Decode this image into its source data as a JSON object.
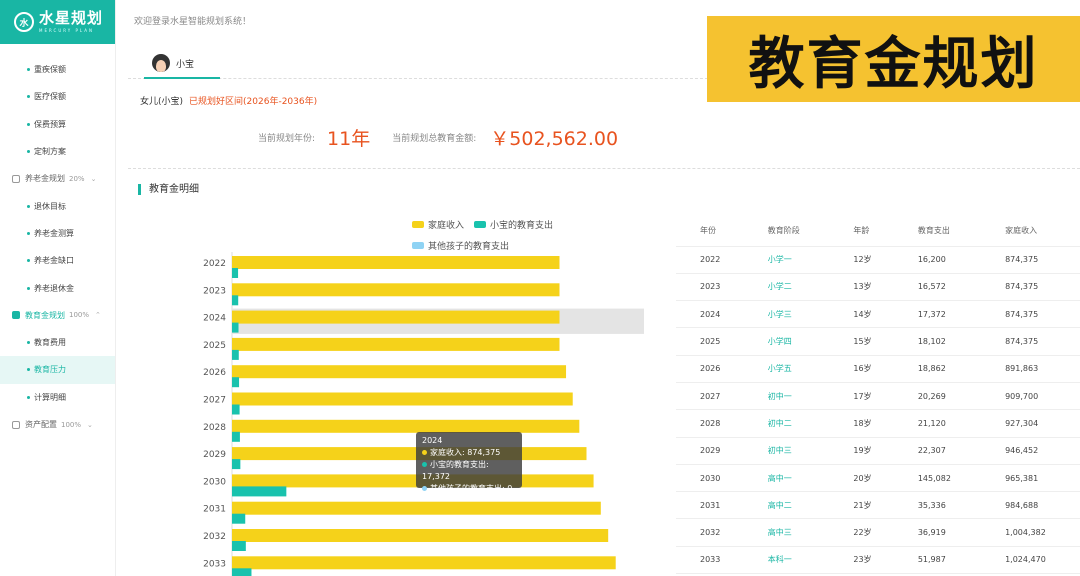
{
  "app": {
    "logo_name": "水星规划",
    "logo_sub": "MERCURY PLAN",
    "welcome": "欢迎登录水星智能规划系统！"
  },
  "sidebar": {
    "items": [
      {
        "label": "重疾保额",
        "type": "sub"
      },
      {
        "label": "医疗保额",
        "type": "sub"
      },
      {
        "label": "保费预算",
        "type": "sub"
      },
      {
        "label": "定制方案",
        "type": "sub"
      },
      {
        "label": "养老金规划",
        "type": "group",
        "pct": "20%"
      },
      {
        "label": "退休目标",
        "type": "sub"
      },
      {
        "label": "养老金测算",
        "type": "sub"
      },
      {
        "label": "养老金缺口",
        "type": "sub"
      },
      {
        "label": "养老退休金",
        "type": "sub"
      },
      {
        "label": "教育金规划",
        "type": "group",
        "pct": "100%",
        "open": true
      },
      {
        "label": "教育费用",
        "type": "sub"
      },
      {
        "label": "教育压力",
        "type": "sub",
        "active": true
      },
      {
        "label": "计算明细",
        "type": "sub"
      },
      {
        "label": "资产配置",
        "type": "group",
        "pct": "100%"
      }
    ]
  },
  "tab": {
    "label": "小宝"
  },
  "banner": "教育金规划",
  "child": {
    "name": "女儿(小宝)",
    "range": "已规划好区间(2026年-2036年)"
  },
  "summary": {
    "years_label": "当前规划年份:",
    "years_value": "11年",
    "amount_label": "当前规划总教育金额:",
    "amount_value": "￥502,562.00"
  },
  "section_title": "教育金明细",
  "colors": {
    "accent": "#19b6a4",
    "income": "#f5d21a",
    "child": "#19c2ad",
    "other": "#8fd3f4",
    "orange": "#e8531f"
  },
  "chart_data": {
    "type": "bar",
    "orientation": "horizontal",
    "categories": [
      "2022",
      "2023",
      "2024",
      "2025",
      "2026",
      "2027",
      "2028",
      "2029",
      "2030",
      "2031",
      "2032",
      "2033"
    ],
    "series": [
      {
        "name": "家庭收入",
        "values": [
          874375,
          874375,
          874375,
          874375,
          891863,
          909700,
          927304,
          946452,
          965381,
          984688,
          1004382,
          1024470
        ]
      },
      {
        "name": "小宝的教育支出",
        "values": [
          16200,
          16572,
          17372,
          18102,
          18862,
          20269,
          21120,
          22307,
          145082,
          35336,
          36919,
          51987
        ]
      },
      {
        "name": "其他孩子的教育支出",
        "values": [
          0,
          0,
          0,
          0,
          0,
          0,
          0,
          0,
          0,
          0,
          0,
          0
        ]
      }
    ],
    "highlight_category": "2024",
    "xlim": [
      0,
      1100000
    ]
  },
  "tooltip": {
    "title": "2024",
    "rows": [
      {
        "label": "家庭收入: 874,375",
        "color": "#f5d21a"
      },
      {
        "label": "小宝的教育支出: 17,372",
        "color": "#19c2ad"
      },
      {
        "label": "其他孩子的教育支出: 0",
        "color": "#8fd3f4"
      }
    ]
  },
  "table": {
    "headers": [
      "年份",
      "教育阶段",
      "年龄",
      "教育支出",
      "家庭收入"
    ],
    "rows": [
      [
        "2022",
        "小学一",
        "12岁",
        "16,200",
        "874,375"
      ],
      [
        "2023",
        "小学二",
        "13岁",
        "16,572",
        "874,375"
      ],
      [
        "2024",
        "小学三",
        "14岁",
        "17,372",
        "874,375"
      ],
      [
        "2025",
        "小学四",
        "15岁",
        "18,102",
        "874,375"
      ],
      [
        "2026",
        "小学五",
        "16岁",
        "18,862",
        "891,863"
      ],
      [
        "2027",
        "初中一",
        "17岁",
        "20,269",
        "909,700"
      ],
      [
        "2028",
        "初中二",
        "18岁",
        "21,120",
        "927,304"
      ],
      [
        "2029",
        "初中三",
        "19岁",
        "22,307",
        "946,452"
      ],
      [
        "2030",
        "高中一",
        "20岁",
        "145,082",
        "965,381"
      ],
      [
        "2031",
        "高中二",
        "21岁",
        "35,336",
        "984,688"
      ],
      [
        "2032",
        "高中三",
        "22岁",
        "36,919",
        "1,004,382"
      ],
      [
        "2033",
        "本科一",
        "23岁",
        "51,987",
        "1,024,470"
      ]
    ]
  }
}
